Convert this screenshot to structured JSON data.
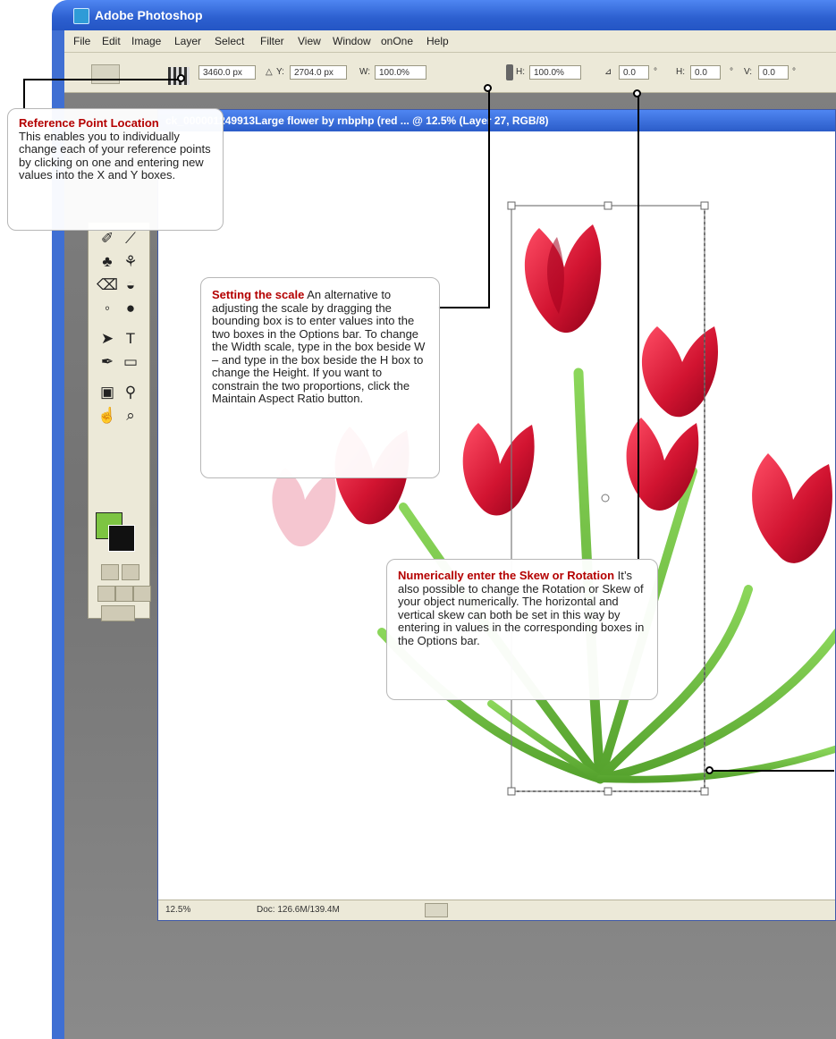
{
  "window": {
    "title": "Adobe Photoshop",
    "icon": "photoshop-app-icon"
  },
  "menu": [
    "File",
    "Edit",
    "Image",
    "Layer",
    "Select",
    "Filter",
    "View",
    "Window",
    "onOne",
    "Help"
  ],
  "options_bar": {
    "x_value": "3460.0 px",
    "y_label": "Y:",
    "y_value": "2704.0 px",
    "w_label": "W:",
    "w_value": "100.0%",
    "h_label": "H:",
    "h_value": "100.0%",
    "rotate_value": "0.0",
    "degree_symbol": "°",
    "h_skew_label": "H:",
    "h_skew_value": "0.0",
    "v_skew_label": "V:",
    "v_skew_value": "0.0"
  },
  "document": {
    "title": "ck_000001249913Large flower by rnbphp (red ... @ 12.5% (Layer 27, RGB/8)",
    "zoom": "12.5%",
    "doc_info": "Doc: 126.6M/139.4M",
    "bounding_box_color": "#7a7a7a",
    "flower_color": "#d21431",
    "stem_color": "#6dbb3d"
  },
  "callouts": {
    "reference_point": {
      "heading": "Reference Point Location",
      "body": "This enables you to individually change each of your reference points by clicking on one and entering new values into the X and Y boxes."
    },
    "setting_scale": {
      "heading": "Setting the scale",
      "body": "An alternative to adjusting the scale by dragging the bounding box is to enter values into the two boxes in the Options bar. To change the Width scale, type in the box beside W – and type in the box beside the H box to change the Height. If you want to constrain the two proportions, click the Maintain Aspect Ratio button."
    },
    "skew_rotation": {
      "heading": "Numerically enter the Skew or Rotation",
      "body": "It’s also possible to change the Rotation or Skew of your object numerically. The horizontal and vertical skew can both be set in this way by entering in values in the corresponding boxes in the Options bar."
    }
  },
  "toolbox": {
    "tools": [
      "healing-brush-icon",
      "brush-icon",
      "clone-stamp-icon",
      "history-brush-icon",
      "eraser-icon",
      "paint-bucket-icon",
      "blur-icon",
      "dodge-icon",
      "path-selection-icon",
      "type-icon",
      "pen-icon",
      "shape-icon",
      "notes-icon",
      "eyedropper-icon",
      "hand-icon",
      "zoom-icon"
    ],
    "foreground_color": "#7dc442",
    "background_color": "#111111",
    "type_glyph": "T"
  }
}
